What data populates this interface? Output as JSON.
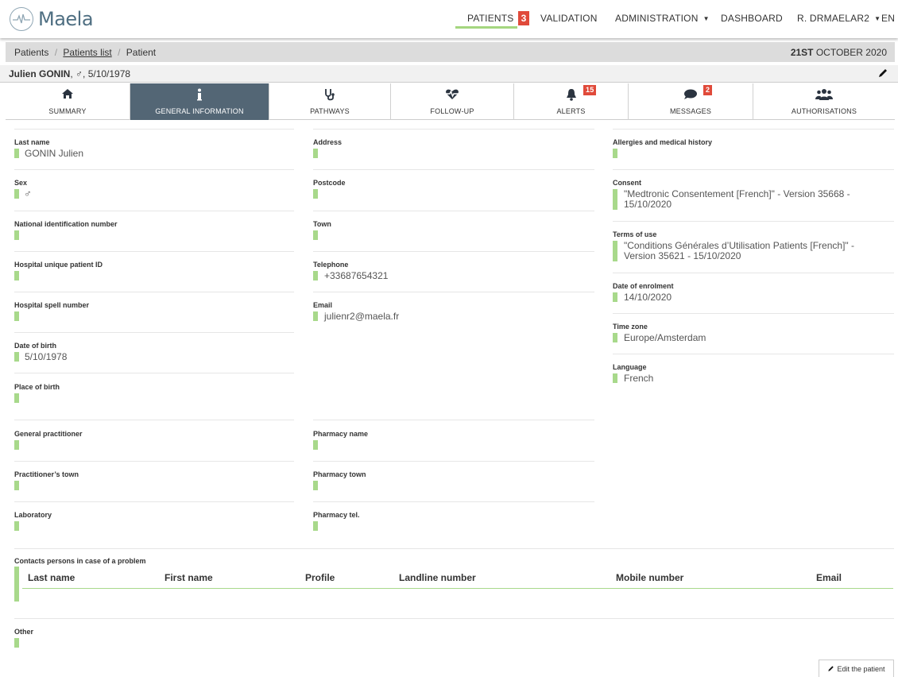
{
  "brand": {
    "name": "Maela"
  },
  "nav": {
    "patients_label": "PATIENTS",
    "patients_badge": "3",
    "validation_label": "VALIDATION",
    "administration_label": "ADMINISTRATION",
    "dashboard_label": "DASHBOARD",
    "user_label": "R. DRMAELAR2",
    "language_label": "EN"
  },
  "breadcrumb": {
    "items": [
      "Patients",
      "Patients list",
      "Patient"
    ],
    "sep": "/",
    "date_day": "21ST",
    "date_rest": "OCTOBER 2020"
  },
  "patient": {
    "name": "Julien GONIN",
    "sex_symbol": "♂",
    "dob": "5/10/1978"
  },
  "tabs": [
    {
      "label": "SUMMARY",
      "icon": "home-icon"
    },
    {
      "label": "GENERAL INFORMATION",
      "icon": "info-icon"
    },
    {
      "label": "PATHWAYS",
      "icon": "stethoscope-icon"
    },
    {
      "label": "FOLLOW-UP",
      "icon": "heartbeat-icon"
    },
    {
      "label": "ALERTS",
      "icon": "bell-icon",
      "badge": "15"
    },
    {
      "label": "MESSAGES",
      "icon": "chat-icon",
      "badge": "2"
    },
    {
      "label": "AUTHORISATIONS",
      "icon": "users-icon"
    }
  ],
  "fields": {
    "last_name": {
      "label": "Last name",
      "value": "GONIN Julien"
    },
    "sex": {
      "label": "Sex",
      "value": "♂"
    },
    "national_id": {
      "label": "National identification number",
      "value": ""
    },
    "hospital_patient_id": {
      "label": "Hospital unique patient ID",
      "value": ""
    },
    "hospital_spell": {
      "label": "Hospital spell number",
      "value": ""
    },
    "date_of_birth": {
      "label": "Date of birth",
      "value": "5/10/1978"
    },
    "place_of_birth": {
      "label": "Place of birth",
      "value": ""
    },
    "address": {
      "label": "Address",
      "value": ""
    },
    "postcode": {
      "label": "Postcode",
      "value": ""
    },
    "town": {
      "label": "Town",
      "value": ""
    },
    "telephone": {
      "label": "Telephone",
      "value": "+33687654321"
    },
    "email": {
      "label": "Email",
      "value": "julienr2@maela.fr"
    },
    "allergies": {
      "label": "Allergies and medical history",
      "value": ""
    },
    "consent": {
      "label": "Consent",
      "value": "\"Medtronic Consentement [French]\" - Version 35668 - 15/10/2020"
    },
    "terms": {
      "label": "Terms of use",
      "value": "\"Conditions Générales d’Utilisation Patients [French]\" - Version 35621 - 15/10/2020"
    },
    "enrolment": {
      "label": "Date of enrolment",
      "value": "14/10/2020"
    },
    "timezone": {
      "label": "Time zone",
      "value": "Europe/Amsterdam"
    },
    "language": {
      "label": "Language",
      "value": "French"
    },
    "gp": {
      "label": "General practitioner",
      "value": ""
    },
    "practitioner_town": {
      "label": "Practitioner’s town",
      "value": ""
    },
    "laboratory": {
      "label": "Laboratory",
      "value": ""
    },
    "pharmacy_name": {
      "label": "Pharmacy name",
      "value": ""
    },
    "pharmacy_town": {
      "label": "Pharmacy town",
      "value": ""
    },
    "pharmacy_tel": {
      "label": "Pharmacy tel.",
      "value": ""
    },
    "other": {
      "label": "Other",
      "value": ""
    }
  },
  "contacts": {
    "label": "Contacts persons in case of a problem",
    "columns": [
      "Last name",
      "First name",
      "Profile",
      "Landline number",
      "Mobile number",
      "Email"
    ]
  },
  "actions": {
    "edit_label": "Edit the patient"
  }
}
